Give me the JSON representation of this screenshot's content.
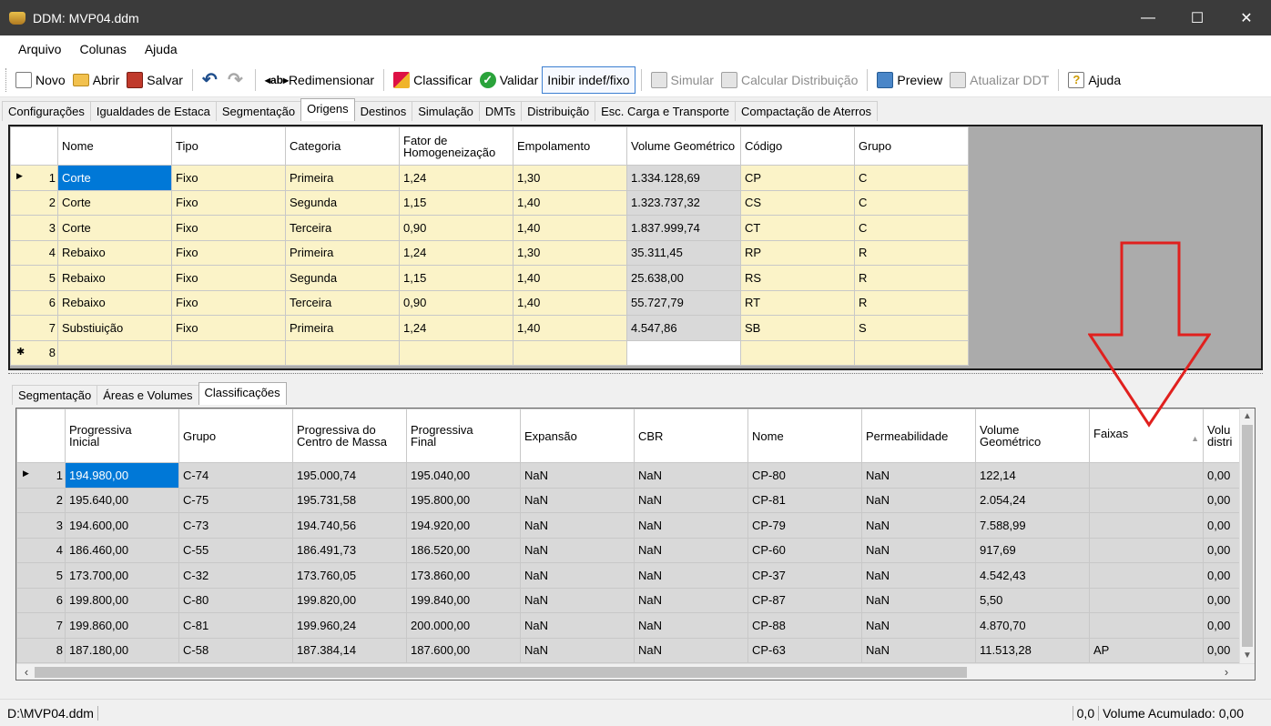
{
  "window": {
    "title": "DDM: MVP04.ddm",
    "controls": [
      "—",
      "☐",
      "✕"
    ]
  },
  "menu": [
    "Arquivo",
    "Colunas",
    "Ajuda"
  ],
  "toolbar": {
    "novo": "Novo",
    "abrir": "Abrir",
    "salvar": "Salvar",
    "redimensionar": "Redimensionar",
    "classificar": "Classificar",
    "validar": "Validar",
    "inibir": "Inibir indef/fixo",
    "simular": "Simular",
    "calcular": "Calcular Distribuição",
    "preview": "Preview",
    "atualizar": "Atualizar DDT",
    "ajuda": "Ajuda"
  },
  "top_tabs": [
    "Configurações",
    "Igualdades de Estaca",
    "Segmentação",
    "Origens",
    "Destinos",
    "Simulação",
    "DMTs",
    "Distribuição",
    "Esc. Carga e Transporte",
    "Compactação de Aterros"
  ],
  "top_tabs_active": "Origens",
  "origens": {
    "headers": [
      "Nome",
      "Tipo",
      "Categoria",
      "Fator de Homogeneização",
      "Empolamento",
      "Volume Geométrico",
      "Código",
      "Grupo"
    ],
    "rows": [
      [
        "1",
        "Corte",
        "Fixo",
        "Primeira",
        "1,24",
        "1,30",
        "1.334.128,69",
        "CP",
        "C"
      ],
      [
        "2",
        "Corte",
        "Fixo",
        "Segunda",
        "1,15",
        "1,40",
        "1.323.737,32",
        "CS",
        "C"
      ],
      [
        "3",
        "Corte",
        "Fixo",
        "Terceira",
        "0,90",
        "1,40",
        "1.837.999,74",
        "CT",
        "C"
      ],
      [
        "4",
        "Rebaixo",
        "Fixo",
        "Primeira",
        "1,24",
        "1,30",
        "35.311,45",
        "RP",
        "R"
      ],
      [
        "5",
        "Rebaixo",
        "Fixo",
        "Segunda",
        "1,15",
        "1,40",
        "25.638,00",
        "RS",
        "R"
      ],
      [
        "6",
        "Rebaixo",
        "Fixo",
        "Terceira",
        "0,90",
        "1,40",
        "55.727,79",
        "RT",
        "R"
      ],
      [
        "7",
        "Substiuição",
        "Fixo",
        "Primeira",
        "1,24",
        "1,40",
        "4.547,86",
        "SB",
        "S"
      ]
    ],
    "new_row_number": "8"
  },
  "bottom_tabs": [
    "Segmentação",
    "Áreas e Volumes",
    "Classificações"
  ],
  "bottom_tabs_active": "Classificações",
  "classificacoes": {
    "headers": [
      "Progressiva Inicial",
      "Grupo",
      "Progressiva do Centro de Massa",
      "Progressiva Final",
      "Expansão",
      "CBR",
      "Nome",
      "Permeabilidade",
      "Volume Geométrico",
      "Faixas",
      "Volu distri"
    ],
    "rows": [
      [
        "1",
        "194.980,00",
        "C-74",
        "195.000,74",
        "195.040,00",
        "NaN",
        "NaN",
        "CP-80",
        "NaN",
        "122,14",
        "",
        "0,00"
      ],
      [
        "2",
        "195.640,00",
        "C-75",
        "195.731,58",
        "195.800,00",
        "NaN",
        "NaN",
        "CP-81",
        "NaN",
        "2.054,24",
        "",
        "0,00"
      ],
      [
        "3",
        "194.600,00",
        "C-73",
        "194.740,56",
        "194.920,00",
        "NaN",
        "NaN",
        "CP-79",
        "NaN",
        "7.588,99",
        "",
        "0,00"
      ],
      [
        "4",
        "186.460,00",
        "C-55",
        "186.491,73",
        "186.520,00",
        "NaN",
        "NaN",
        "CP-60",
        "NaN",
        "917,69",
        "",
        "0,00"
      ],
      [
        "5",
        "173.700,00",
        "C-32",
        "173.760,05",
        "173.860,00",
        "NaN",
        "NaN",
        "CP-37",
        "NaN",
        "4.542,43",
        "",
        "0,00"
      ],
      [
        "6",
        "199.800,00",
        "C-80",
        "199.820,00",
        "199.840,00",
        "NaN",
        "NaN",
        "CP-87",
        "NaN",
        "5,50",
        "",
        "0,00"
      ],
      [
        "7",
        "199.860,00",
        "C-81",
        "199.960,24",
        "200.000,00",
        "NaN",
        "NaN",
        "CP-88",
        "NaN",
        "4.870,70",
        "",
        "0,00"
      ],
      [
        "8",
        "187.180,00",
        "C-58",
        "187.384,14",
        "187.600,00",
        "NaN",
        "NaN",
        "CP-63",
        "NaN",
        "11.513,28",
        "AP",
        "0,00"
      ]
    ]
  },
  "status": {
    "file": "D:\\MVP04.ddm",
    "value": "0,0",
    "volume": "Volume Acumulado: 0,00"
  },
  "colors": {
    "titlebar": "#3b3b3b",
    "cell_yellow": "#fbf3c8",
    "cell_gray": "#d9d9d9",
    "selection": "#0078d7",
    "annotation_arrow": "#e0201e"
  }
}
